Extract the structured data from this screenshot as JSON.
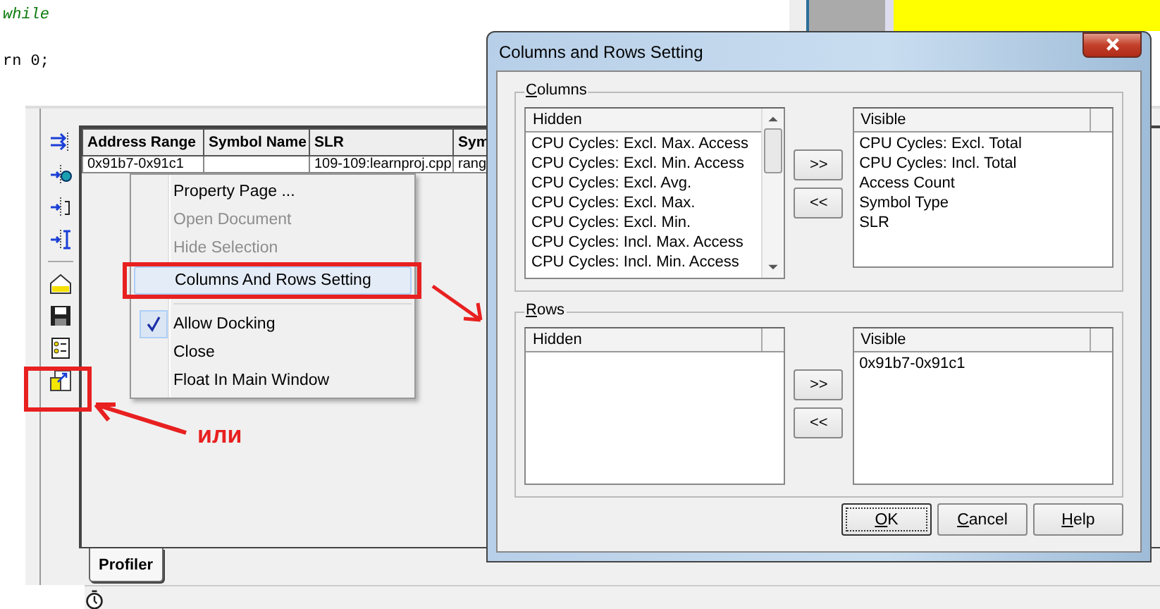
{
  "code_lines": [
    "while",
    "rn 0;"
  ],
  "table": {
    "columns": [
      "Address Range",
      "Symbol Name",
      "SLR",
      "Sym"
    ],
    "rows": [
      [
        "0x91b7-0x91c1",
        "",
        "109-109:learnproj.cpp",
        "rang"
      ]
    ]
  },
  "tabs": [
    {
      "label": "Profiler",
      "selected": true
    }
  ],
  "context_menu": {
    "items": [
      {
        "label": "Property Page ...",
        "disabled": false,
        "checked": false,
        "highlighted": false,
        "separator_before": false
      },
      {
        "label": "Open Document",
        "disabled": true,
        "checked": false,
        "highlighted": false,
        "separator_before": false
      },
      {
        "label": "Hide Selection",
        "disabled": true,
        "checked": false,
        "highlighted": false,
        "separator_before": false
      },
      {
        "label": "Columns And Rows Setting",
        "disabled": false,
        "checked": false,
        "highlighted": true,
        "separator_before": false
      },
      {
        "label": "Allow Docking",
        "disabled": false,
        "checked": true,
        "highlighted": false,
        "separator_before": true
      },
      {
        "label": "Close",
        "disabled": false,
        "checked": false,
        "highlighted": false,
        "separator_before": false
      },
      {
        "label": "Float In Main Window",
        "disabled": false,
        "checked": false,
        "highlighted": false,
        "separator_before": false
      }
    ]
  },
  "dialog": {
    "title": "Columns and Rows Setting",
    "groups": [
      {
        "label": "Columns",
        "hidden_header": "Hidden",
        "visible_header": "Visible",
        "scrollable": true,
        "hidden": [
          "CPU Cycles: Excl. Max. Access",
          "CPU Cycles: Excl. Min. Access",
          "CPU Cycles: Excl. Avg.",
          "CPU Cycles: Excl. Max.",
          "CPU Cycles: Excl. Min.",
          "CPU Cycles: Incl. Max. Access",
          "CPU Cycles: Incl. Min. Access"
        ],
        "visible": [
          "CPU Cycles: Excl. Total",
          "CPU Cycles: Incl. Total",
          "Access Count",
          "Symbol Type",
          "SLR"
        ],
        "move_right": ">>",
        "move_left": "<<"
      },
      {
        "label": "Rows",
        "hidden_header": "Hidden",
        "visible_header": "Visible",
        "scrollable": false,
        "visible": [
          "0x91b7-0x91c1"
        ],
        "move_right": ">>",
        "move_left": "<<"
      }
    ],
    "buttons": [
      {
        "label": "OK",
        "default": true
      },
      {
        "label": "Cancel",
        "default": false
      },
      {
        "label": "Help",
        "default": false
      }
    ]
  },
  "annotation": {
    "text": "или"
  }
}
